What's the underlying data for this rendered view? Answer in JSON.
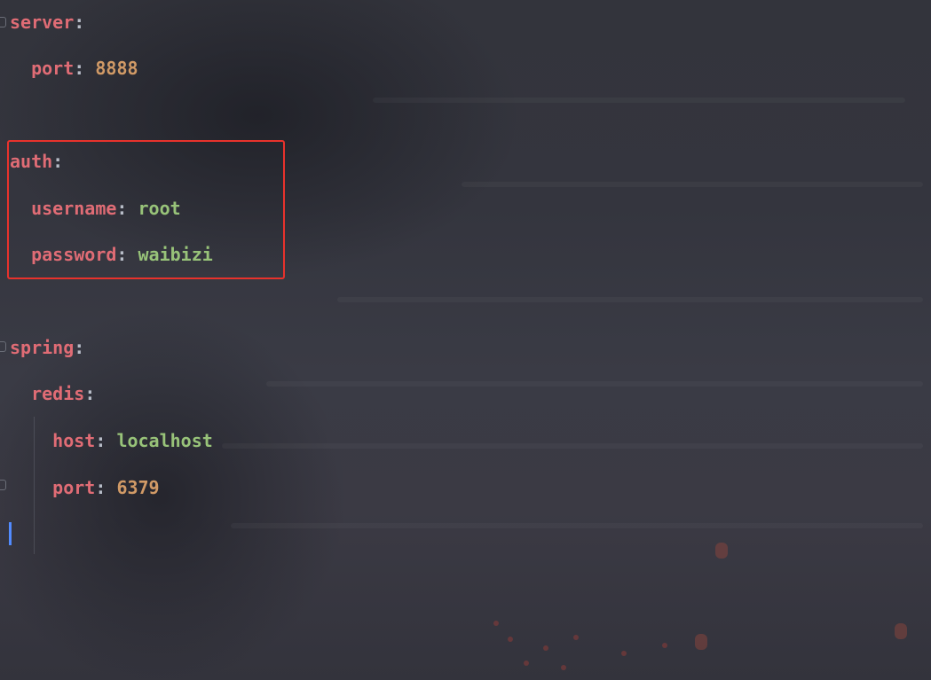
{
  "editor": {
    "lines": [
      {
        "key": "server",
        "sep": ":"
      },
      {
        "key": "port",
        "sep": ": ",
        "value": "8888"
      },
      {
        "key": "auth",
        "sep": ":"
      },
      {
        "key": "username",
        "sep": ": ",
        "value": "root"
      },
      {
        "key": "password",
        "sep": ": ",
        "value": "waibizi"
      },
      {
        "key": "spring",
        "sep": ":"
      },
      {
        "key": "redis",
        "sep": ":"
      },
      {
        "key": "host",
        "sep": ": ",
        "value": "localhost"
      },
      {
        "key": "port",
        "sep": ": ",
        "value": "6379"
      }
    ]
  },
  "colors": {
    "key": "#e06c75",
    "number": "#d19a66",
    "string": "#98c379",
    "highlight_box": "#e8322c",
    "caret": "#528bff"
  },
  "icons": [
    "fold-marker-icon"
  ]
}
